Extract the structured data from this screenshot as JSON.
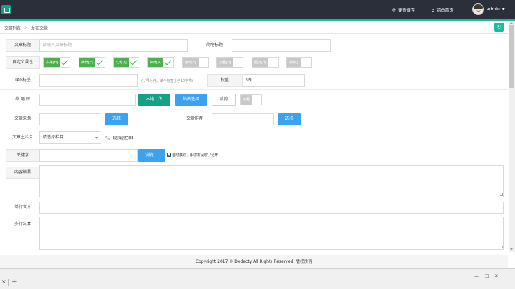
{
  "header": {
    "clear_cache": "更新缓存",
    "home": "前台首页",
    "user": "admin"
  },
  "breadcrumb": {
    "item1": "文章列表",
    "separator": ">",
    "item2": "发布文章"
  },
  "form": {
    "title_label": "文章标题",
    "title_placeholder": "请输入文章标题",
    "short_title_label": "简略标题",
    "attr_label": "自定义属性",
    "attrs": [
      {
        "label": "头条[h]",
        "checked": true
      },
      {
        "label": "推荐[c]",
        "checked": true
      },
      {
        "label": "幻灯[f]",
        "checked": true
      },
      {
        "label": "特荐[a]",
        "checked": true
      },
      {
        "label": "滚动[s]",
        "checked": false
      },
      {
        "label": "加粗[b]",
        "checked": false
      },
      {
        "label": "图片[p]",
        "checked": false
      },
      {
        "label": "跳转[j]",
        "checked": false
      }
    ],
    "tag_label": "TAG标签",
    "tag_hint": "(‘,’号分开，单个标签小于12字节)",
    "weight_label": "权重",
    "weight_value": "99",
    "thumb_label": "缩 略 图",
    "upload_local": "本地上传",
    "site_select": "站内选择",
    "crop": "裁剪",
    "remote": "远程",
    "source_label": "文章来源",
    "select_btn": "选择",
    "author_label": "文章作者",
    "select_btn2": "选择",
    "column_label": "文章主栏目",
    "column_placeholder": "请选择栏目...",
    "sub_column": "【选择副栏目】",
    "keywords_label": "关键字",
    "browse_btn": "浏览...",
    "auto_get": "自动获取，手动填写用\",\"分开",
    "summary_label": "内容摘要",
    "single_text_label": "单行文本",
    "multi_text_label": "多行文本"
  },
  "footer": {
    "copyright": "Copyright 2017 © Dedecty All Rights Reserved. 版权所有"
  },
  "window": {
    "minimize": "—",
    "maximize": "□",
    "close": "✕"
  },
  "tabbar": {
    "close": "×",
    "add": "+"
  },
  "colors": {
    "topbar": "#2a2f3a",
    "accent": "#1abc9c",
    "on": "#4cb050",
    "blue": "#3ba2f0"
  }
}
